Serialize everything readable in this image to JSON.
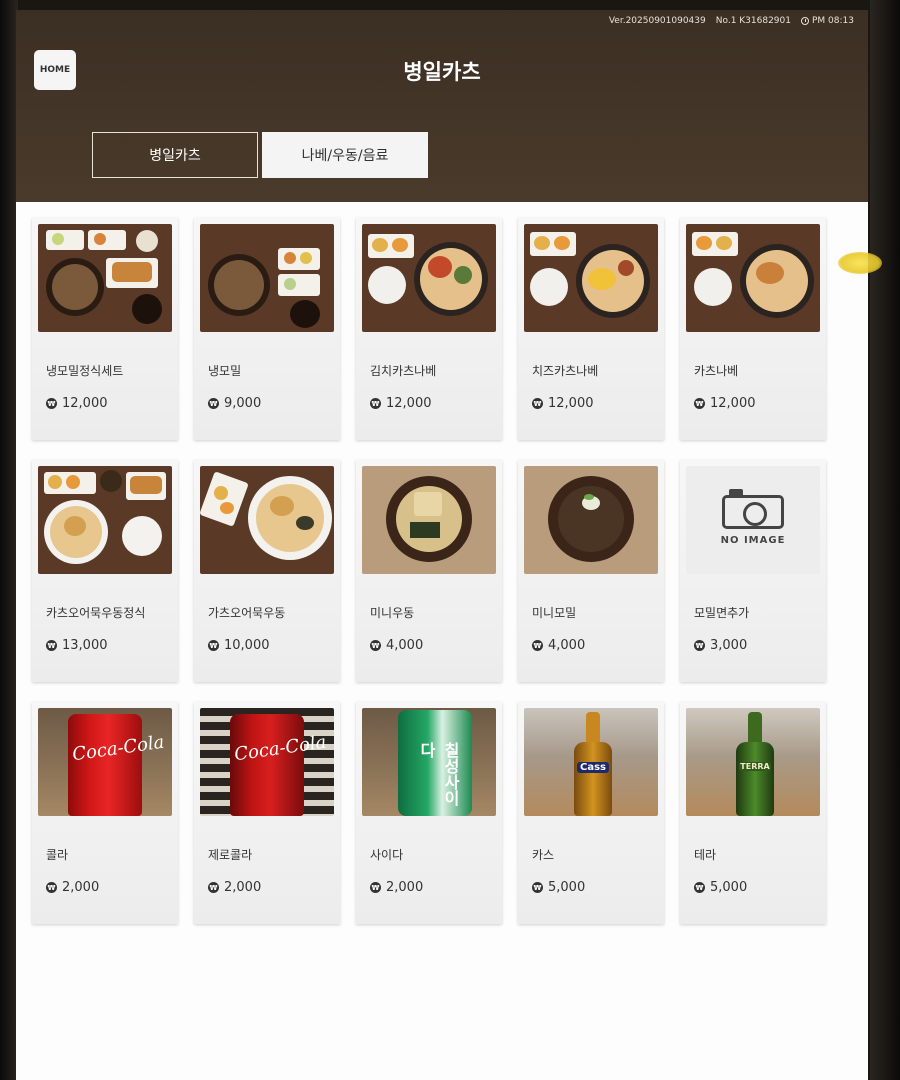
{
  "status": {
    "version": "Ver.20250901090439",
    "number": "No.1 K31682901",
    "time": "PM 08:13"
  },
  "header": {
    "home_label": "HOME",
    "store_name": "병일카츠"
  },
  "tabs": [
    {
      "label": "병일카츠",
      "active": true
    },
    {
      "label": "나베/우동/음료",
      "active": false
    }
  ],
  "menu": [
    {
      "name": "냉모밀정식세트",
      "price": "12,000"
    },
    {
      "name": "냉모밀",
      "price": "9,000"
    },
    {
      "name": "김치카츠나베",
      "price": "12,000"
    },
    {
      "name": "치즈카츠나베",
      "price": "12,000"
    },
    {
      "name": "카츠나베",
      "price": "12,000"
    },
    {
      "name": "카츠오어묵우동정식",
      "price": "13,000"
    },
    {
      "name": "가츠오어묵우동",
      "price": "10,000"
    },
    {
      "name": "미니우동",
      "price": "4,000"
    },
    {
      "name": "미니모밀",
      "price": "4,000"
    },
    {
      "name": "모밀면추가",
      "price": "3,000"
    },
    {
      "name": "콜라",
      "price": "2,000"
    },
    {
      "name": "제로콜라",
      "price": "2,000"
    },
    {
      "name": "사이다",
      "price": "2,000"
    },
    {
      "name": "카스",
      "price": "5,000"
    },
    {
      "name": "테라",
      "price": "5,000"
    }
  ],
  "image_text": {
    "no_image": "NO IMAGE",
    "coke_can": "Coca-Cola",
    "zero_can": "Coca-Cola",
    "cider_can": "칠성사이다",
    "cass_label": "Cass",
    "terra_label": "TERRA"
  },
  "currency_symbol": "₩"
}
